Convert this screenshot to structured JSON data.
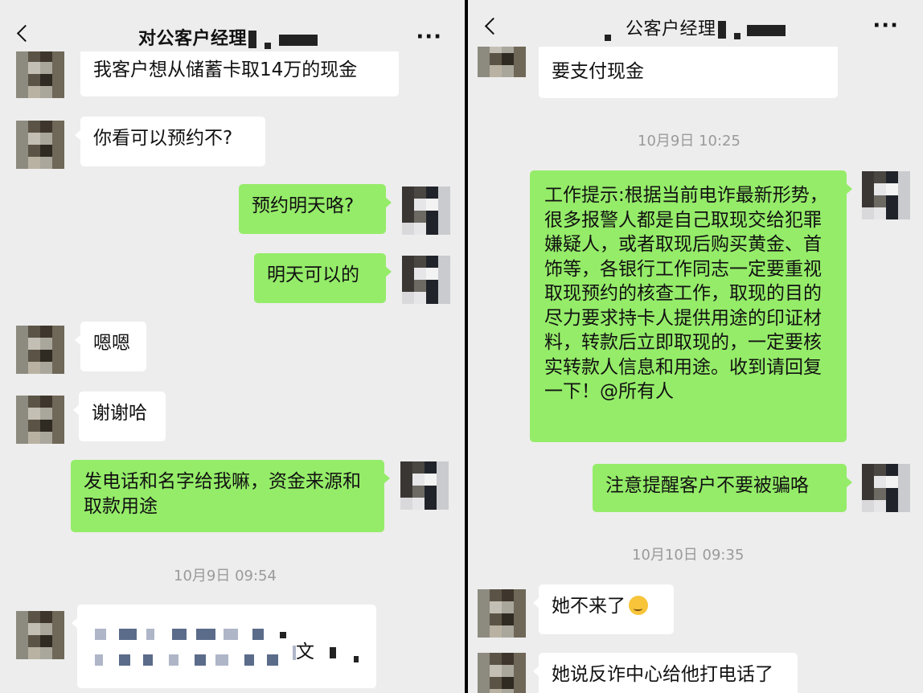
{
  "left": {
    "title": "对公客户经理",
    "messages": [
      {
        "text": "我客户想从储蓄卡取14万的现金"
      },
      {
        "text": "你看可以预约不?"
      },
      {
        "text": "预约明天咯?"
      },
      {
        "text": "明天可以的"
      },
      {
        "text": "嗯嗯"
      },
      {
        "text": "谢谢哈"
      },
      {
        "text": "发电话和名字给我嘛，资金来源和取款用途"
      }
    ],
    "timestamp": "10月9日 09:54",
    "partial_fragment": "文"
  },
  "right": {
    "title": "公客户经理",
    "top_partial": "要支付现金",
    "timestamp1": "10月9日 10:25",
    "notice": "工作提示:根据当前电诈最新形势，很多报警人都是自己取现交给犯罪嫌疑人，或者取现后购买黄金、首饰等，各银行工作同志一定要重视取现预约的核查工作，取现的目的尽力要求持卡人提供用途的印证材料，转款后立即取现的，一定要核实转款人信息和用途。收到请回复一下！@所有人",
    "reminder": "注意提醒客户不要被骗咯",
    "timestamp2": "10月10日 09:35",
    "reply1": "她不来了",
    "reply1_emoji": "thinking-face-icon",
    "reply2": "她说反诈中心给他打电话了"
  },
  "colors": {
    "chat_background": "#ededed",
    "incoming_bubble": "#ffffff",
    "outgoing_bubble": "#95ec69",
    "timestamp_text": "#9a9a9a"
  }
}
